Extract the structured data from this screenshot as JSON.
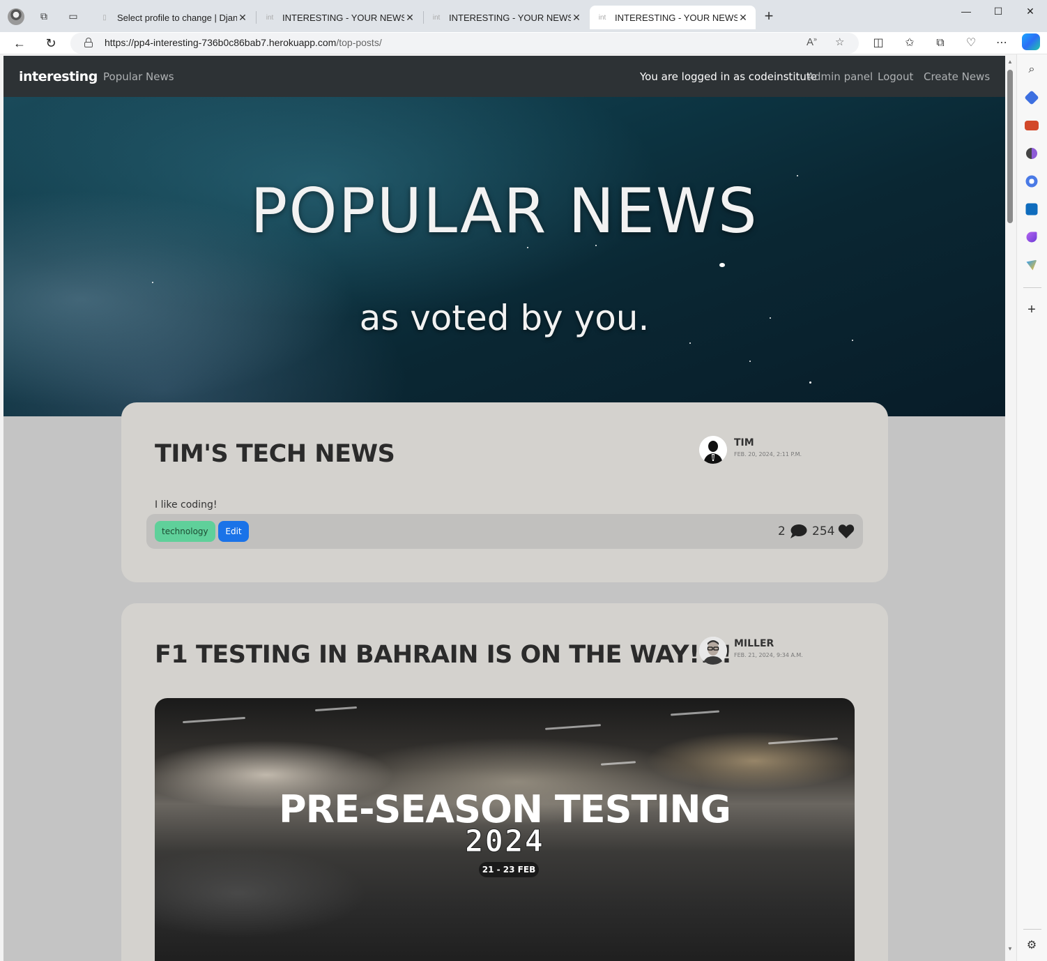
{
  "browser": {
    "tabs": [
      {
        "title": "Select profile to change | Django site admin",
        "active": false
      },
      {
        "title": "INTERESTING - YOUR NEWS FIX",
        "active": false
      },
      {
        "title": "INTERESTING - YOUR NEWS FIX",
        "active": false
      },
      {
        "title": "INTERESTING - YOUR NEWS FIX",
        "active": true
      }
    ],
    "url_host": "https://pp4-interesting-736b0c86bab7.herokuapp.com",
    "url_path": "/top-posts/"
  },
  "nav": {
    "brand": "interesting",
    "popular": "Popular News",
    "logged_in_text": "You are logged in as codeinstitute",
    "admin": "Admin panel",
    "logout": "Logout",
    "create": "Create News"
  },
  "hero": {
    "title": "POPULAR NEWS",
    "subtitle": "as voted by you."
  },
  "posts": [
    {
      "title": "TIM'S TECH NEWS",
      "author": "TIM",
      "date": "FEB. 20, 2024, 2:11 P.M.",
      "body": "I like coding!",
      "tag": "technology",
      "edit": "Edit",
      "comments": "2",
      "likes": "254"
    },
    {
      "title": "F1 TESTING IN BAHRAIN IS ON THE WAY!!!!",
      "author": "MILLER",
      "date": "FEB. 21, 2024, 9:34 A.M.",
      "image": {
        "headline": "PRE-SEASON TESTING",
        "year": "2024",
        "dates": "21 - 23 FEB"
      }
    }
  ],
  "colors": {
    "nav_bg": "#2d3235",
    "page_bg": "#c4c4c4",
    "card_bg": "#d4d2ce",
    "tag_bg": "#5fd09a",
    "edit_bg": "#1a73e8"
  }
}
